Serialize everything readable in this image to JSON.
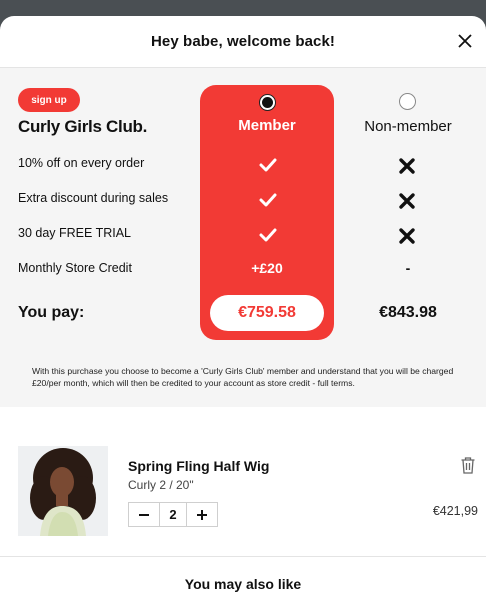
{
  "header": {
    "title": "Hey babe, welcome back!"
  },
  "club": {
    "signup_label": "sign up",
    "brand_name": "Curly Girls Club.",
    "member_label": "Member",
    "non_member_label": "Non-member",
    "rows": [
      {
        "label": "10% off on every order",
        "member": "check-icon",
        "non_member": "cross-icon"
      },
      {
        "label": "Extra discount during sales",
        "member": "check-icon",
        "non_member": "cross-icon"
      },
      {
        "label": "30 day FREE TRIAL",
        "member": "check-icon",
        "non_member": "cross-icon"
      },
      {
        "label": "Monthly Store Credit",
        "member": "+£20",
        "non_member": "-"
      }
    ],
    "you_pay_label": "You pay:",
    "member_price": "€759.58",
    "non_member_price": "€843.98",
    "disclaimer": "With this purchase you choose to become a 'Curly Girls Club' member and understand that you will be charged £20/per month, which will then be credited to your account as store credit - full terms.",
    "selected": "member",
    "accent_color": "#f23a35"
  },
  "cart_item": {
    "name": "Spring Fling Half Wig",
    "variant": "Curly 2 / 20\"",
    "quantity": "2",
    "price": "€421,99"
  },
  "also_like": {
    "title": "You may also like"
  }
}
